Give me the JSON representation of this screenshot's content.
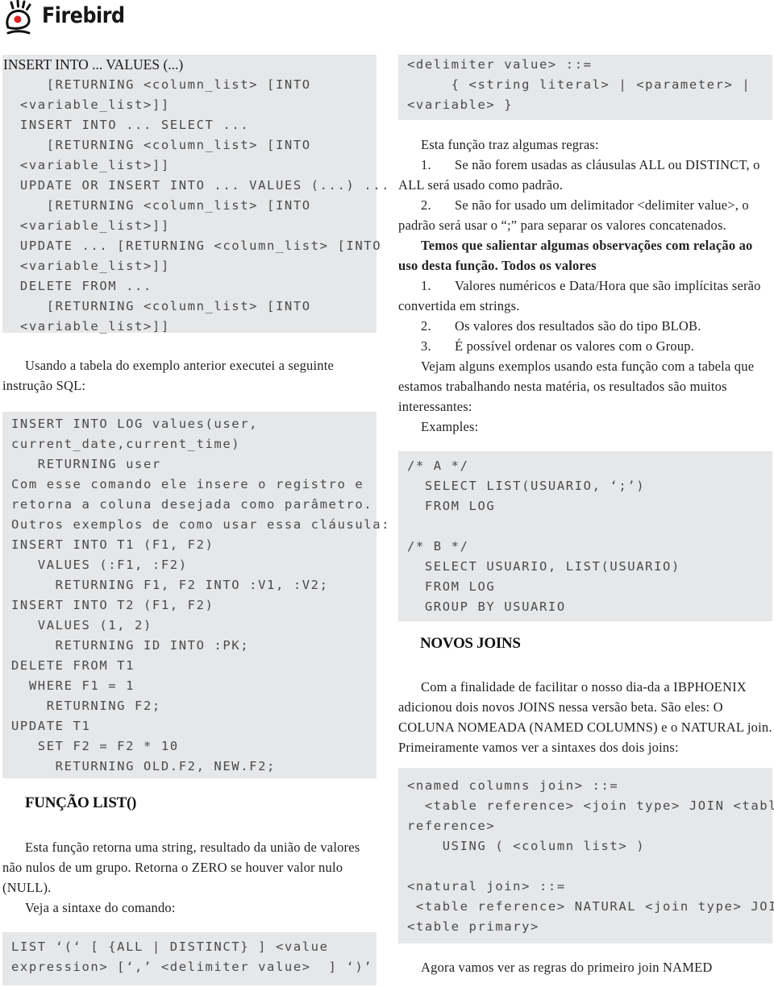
{
  "header": {
    "brand": "Firebird",
    "logo_icon": "firebird-eye-logo-icon",
    "accent_color": "#e02020"
  },
  "left_column": {
    "syntax_box": {
      "lines": [
        "INSERT INTO ... VALUES (...)",
        "    [RETURNING <column_list> [INTO",
        " <variable_list>]]",
        " INSERT INTO ... SELECT ...",
        "    [RETURNING <column_list> [INTO",
        " <variable_list>]]",
        " UPDATE OR INSERT INTO ... VALUES (...) ...",
        "    [RETURNING <column_list> [INTO",
        " <variable_list>]]",
        " UPDATE ... [RETURNING <column_list> [INTO",
        " <variable_list>]]",
        " DELETE FROM ...",
        "    [RETURNING <column_list> [INTO",
        " <variable_list>]]"
      ]
    },
    "paragraph_1": "Usando a tabela do exemplo anterior executei a seguinte instrução SQL:",
    "example_box": {
      "lines": [
        "INSERT INTO LOG values(user,",
        "current_date,current_time)",
        "   RETURNING user",
        "Com esse comando ele insere o registro e",
        "retorna a coluna desejada como parâmetro.",
        "Outros exemplos de como usar essa cláusula:",
        "INSERT INTO T1 (F1, F2)",
        "   VALUES (:F1, :F2)",
        "     RETURNING F1, F2 INTO :V1, :V2;",
        "INSERT INTO T2 (F1, F2)",
        "   VALUES (1, 2)",
        "     RETURNING ID INTO :PK;",
        "DELETE FROM T1",
        "  WHERE F1 = 1",
        "    RETURNING F2;",
        "UPDATE T1",
        "   SET F2 = F2 * 10",
        "     RETURNING OLD.F2, NEW.F2;"
      ]
    },
    "heading_list": "FUNÇÃO LIST()",
    "paragraph_2": "Esta função retorna uma string, resultado da união de valores não nulos de um grupo. Retorna o ZERO se houver valor nulo (NULL).",
    "paragraph_3": "Veja a sintaxe do comando:",
    "list_syntax_box": {
      "lines": [
        "LIST ‘(‘ [ {ALL | DISTINCT} ] <value",
        "expression> [‘,’ <delimiter value>  ] ‘)’"
      ]
    }
  },
  "right_column": {
    "delimiter_box": {
      "lines": [
        "<delimiter value> ::=",
        "     { <string literal> | <parameter> |",
        "<variable> }"
      ]
    },
    "rules_intro": "Esta função traz algumas regras:",
    "rules": [
      {
        "num": "1.",
        "text": "Se não forem usadas as cláusulas ALL ou DISTINCT, o ALL será usado como padrão."
      },
      {
        "num": "2.",
        "text": "Se não for usado um delimitador <delimiter value>, o padrão será usar o “;” para separar os valores concatenados."
      }
    ],
    "observations_bold": "Temos que salientar algumas observações com relação ao uso desta função. Todos os valores",
    "observations": [
      {
        "num": "1.",
        "text": "Valores numéricos e Data/Hora que são implícitas serão convertida em strings."
      },
      {
        "num": "2.",
        "text": "Os valores dos resultados são do tipo BLOB."
      },
      {
        "num": "3.",
        "text": "É possível ordenar os valores com o Group."
      }
    ],
    "examples_paragraph": "Vejam alguns exemplos usando esta função com a tabela que estamos trabalhando nesta matéria, os resultados são muitos interessantes:",
    "examples_label": "Examples:",
    "examples_box": {
      "lines": [
        "/* A */",
        "  SELECT LIST(USUARIO, ‘;’)",
        "  FROM LOG",
        "",
        "/* B */",
        "  SELECT USUARIO, LIST(USUARIO)",
        "  FROM LOG",
        "  GROUP BY USUARIO"
      ]
    },
    "heading_joins": "NOVOS JOINS",
    "joins_paragraph": "Com a finalidade de facilitar o nosso dia-da a IBPHOENIX adicionou dois novos JOINS nessa versão beta. São eles: O COLUNA NOMEADA (NAMED COLUMNS) e o NATURAL join. Primeiramente vamos ver a sintaxes dos dois joins:",
    "joins_box": {
      "lines": [
        "<named columns join> ::=",
        "  <table reference> <join type> JOIN <table",
        "reference>",
        "    USING ( <column list> )",
        "",
        "<natural join> ::=",
        " <table reference> NATURAL <join type> JOIN",
        "<table primary>"
      ]
    },
    "closing_line": "Agora vamos ver as regras do primeiro join NAMED"
  }
}
